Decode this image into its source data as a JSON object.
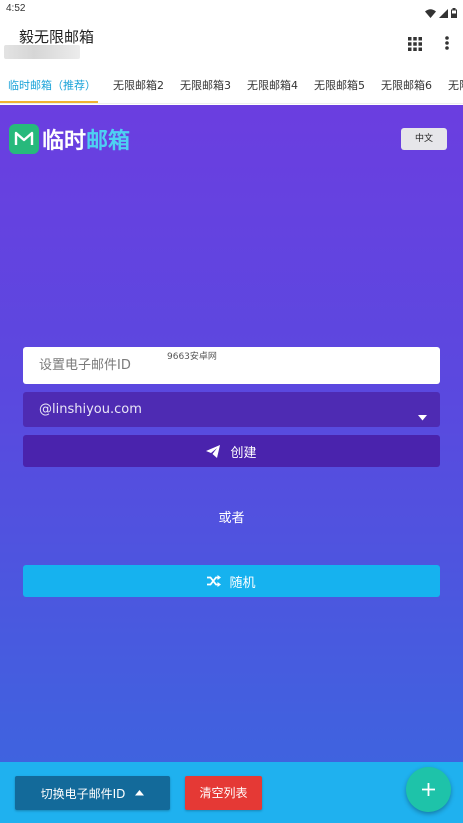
{
  "status_bar": {
    "time": "4:52",
    "icons": [
      "wifi-icon",
      "signal-icon",
      "battery-icon"
    ]
  },
  "app_bar": {
    "title": "毅无限邮箱",
    "actions": [
      "grid-icon",
      "more-vert-icon"
    ]
  },
  "tabs": [
    {
      "label": "临时邮箱（推荐）",
      "active": true
    },
    {
      "label": "无限邮箱2"
    },
    {
      "label": "无限邮箱3"
    },
    {
      "label": "无限邮箱4"
    },
    {
      "label": "无限邮箱5"
    },
    {
      "label": "无限邮箱6"
    },
    {
      "label": "无限邮"
    }
  ],
  "main": {
    "logo": {
      "part1": "临时",
      "part2": "邮箱",
      "icon": "mail-m-icon"
    },
    "language_button": "中文",
    "email_input": {
      "placeholder": "设置电子邮件ID",
      "value": ""
    },
    "watermark": "9663安卓网",
    "domain_select": {
      "value": "@linshiyou.com"
    },
    "create_button": {
      "label": "创建",
      "icon": "send-icon"
    },
    "or_text": "或者",
    "random_button": {
      "label": "随机",
      "icon": "shuffle-icon"
    }
  },
  "bottom_bar": {
    "switch_button": {
      "label": "切换电子邮件ID",
      "icon": "caret-up-icon"
    },
    "clear_button": "清空列表",
    "fab_icon": "plus-icon"
  },
  "colors": {
    "gradient_top": "#6b3ee0",
    "gradient_bottom": "#3f63df",
    "tab_active": "#1aa3d9",
    "tab_indicator": "#f2b233",
    "bottom_bar": "#1fb1ef",
    "clear_button": "#e53935",
    "fab": "#1ec3a9"
  }
}
